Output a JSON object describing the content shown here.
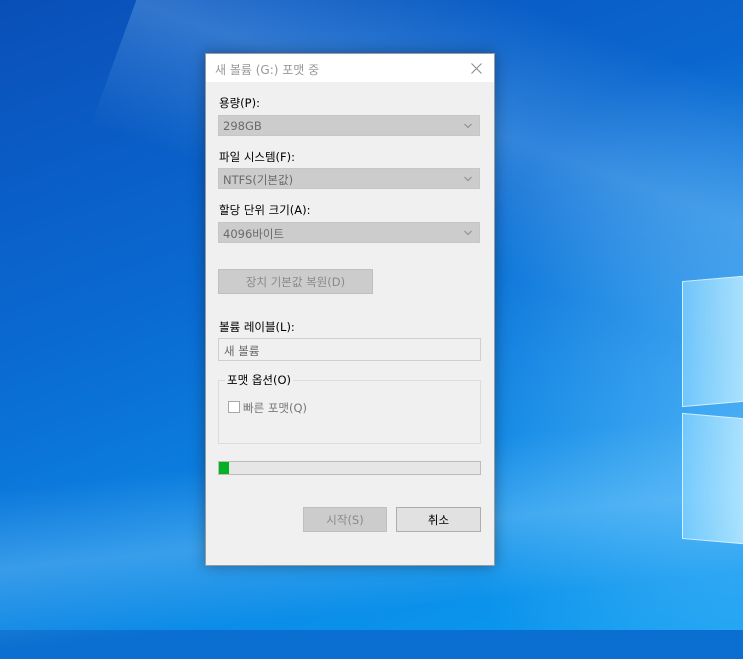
{
  "window": {
    "title": "새 볼륨 (G:) 포맷 중",
    "close_icon": "close-icon"
  },
  "capacity": {
    "label": "용량(P):",
    "value": "298GB"
  },
  "file_system": {
    "label": "파일 시스템(F):",
    "value": "NTFS(기본값)"
  },
  "allocation_unit": {
    "label": "할당 단위 크기(A):",
    "value": "4096바이트"
  },
  "restore_defaults_button": "장치 기본값 복원(D)",
  "volume_label": {
    "label": "볼륨 레이블(L):",
    "value": "새 볼륨"
  },
  "format_options": {
    "legend": "포맷 옵션(O)",
    "quick_format_label": "빠른 포맷(Q)",
    "quick_format_checked": false
  },
  "progress": {
    "fraction": 0.04,
    "color": "#06b025"
  },
  "buttons": {
    "start": "시작(S)",
    "cancel": "취소"
  }
}
